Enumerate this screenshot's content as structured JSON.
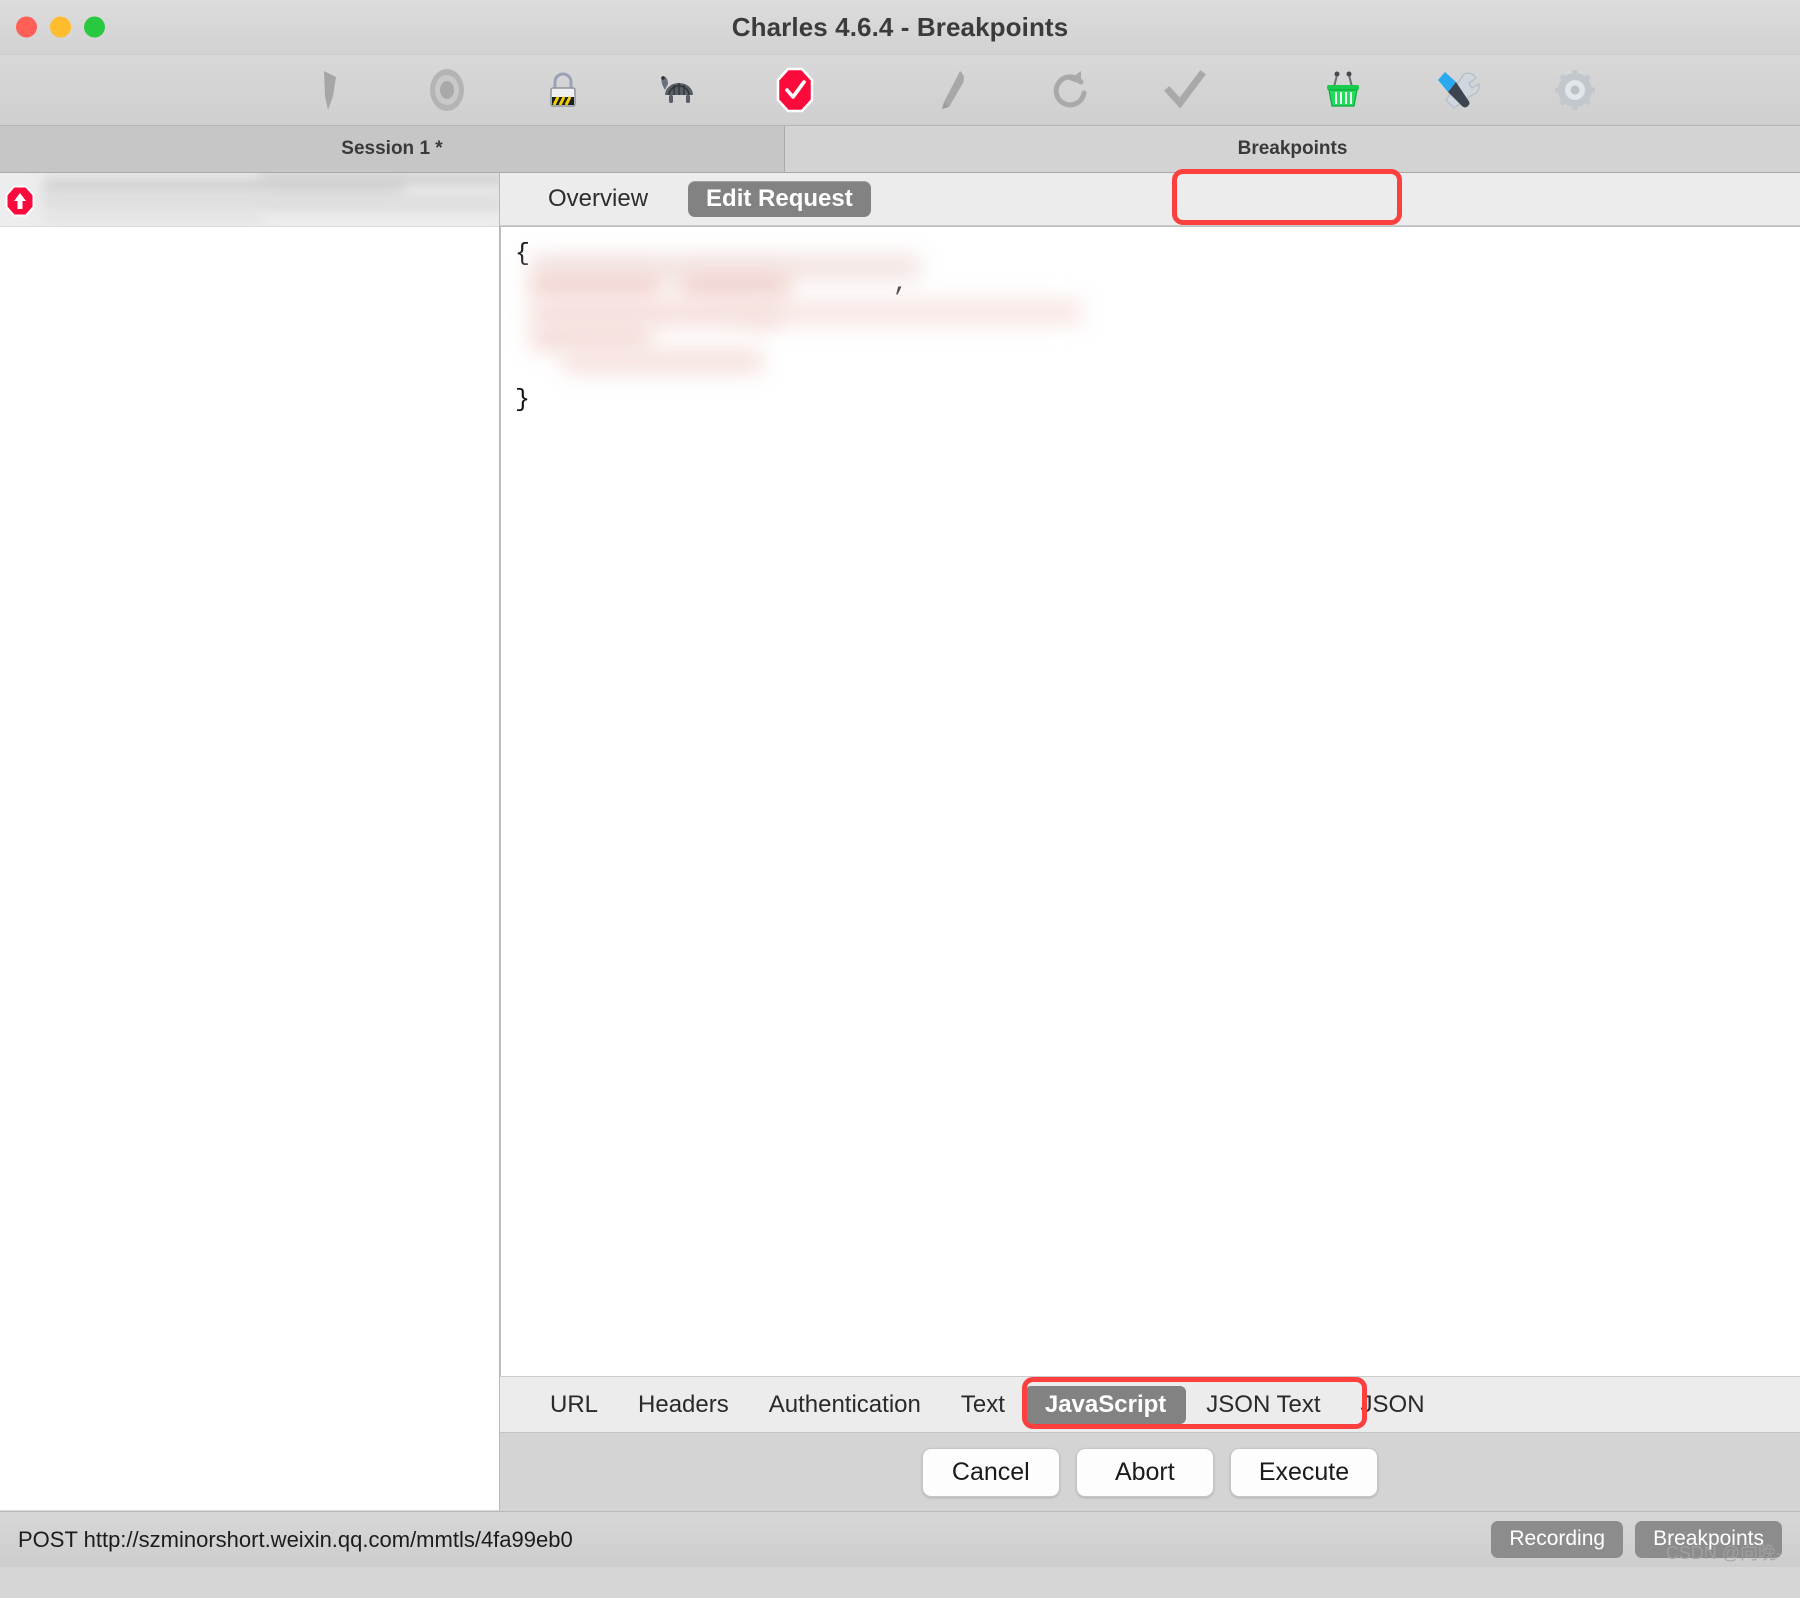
{
  "window": {
    "title": "Charles 4.6.4 - Breakpoints",
    "controls": [
      "close",
      "minimize",
      "maximize"
    ]
  },
  "toolbar": {
    "items": [
      {
        "name": "clear-session-icon",
        "label": "Clear Session"
      },
      {
        "name": "record-stop-icon",
        "label": "Start/Stop Recording"
      },
      {
        "name": "ssl-proxying-icon",
        "label": "SSL Proxying"
      },
      {
        "name": "throttling-icon",
        "label": "Start/Stop Throttling"
      },
      {
        "name": "breakpoints-icon",
        "label": "Enable/Disable Breakpoints"
      },
      {
        "name": "compose-icon",
        "label": "Compose a New Request"
      },
      {
        "name": "repeat-icon",
        "label": "Repeat"
      },
      {
        "name": "validate-icon",
        "label": "Validate"
      },
      {
        "name": "basket-icon",
        "label": "Tools"
      },
      {
        "name": "tools-icon",
        "label": "Tools Settings"
      },
      {
        "name": "settings-gear-icon",
        "label": "Settings"
      }
    ]
  },
  "tabstrip": {
    "session_label": "Session 1 *",
    "breakpoints_label": "Breakpoints"
  },
  "left_pane": {
    "badge": "breakpoint-request-badge",
    "redacted_rows": 3
  },
  "request_tabs": {
    "items": [
      {
        "label": "Overview",
        "active": false
      },
      {
        "label": "Edit Request",
        "active": true
      }
    ],
    "highlight_color": "#fc4040",
    "highlight_target": "Edit Request"
  },
  "editor": {
    "open_brace": "{",
    "close_brace": "}",
    "comma": ",",
    "redacted": true,
    "body_note": "JSON body content is redacted/blurred"
  },
  "bottom_tabs": {
    "items": [
      {
        "label": "URL",
        "active": false
      },
      {
        "label": "Headers",
        "active": false
      },
      {
        "label": "Authentication",
        "active": false
      },
      {
        "label": "Text",
        "active": false
      },
      {
        "label": "JavaScript",
        "active": true
      },
      {
        "label": "JSON Text",
        "active": false
      },
      {
        "label": "JSON",
        "active": false
      }
    ],
    "highlight_color": "#fc4040",
    "highlight_from": "JavaScript",
    "highlight_to": "JSON Text"
  },
  "actions": {
    "cancel_label": "Cancel",
    "abort_label": "Abort",
    "execute_label": "Execute"
  },
  "statusbar": {
    "url": "POST http://szminorshort.weixin.qq.com/mmtls/4fa99eb0",
    "recording_label": "Recording",
    "breakpoints_label": "Breakpoints",
    "watermark": "CSDN @向晚-"
  }
}
